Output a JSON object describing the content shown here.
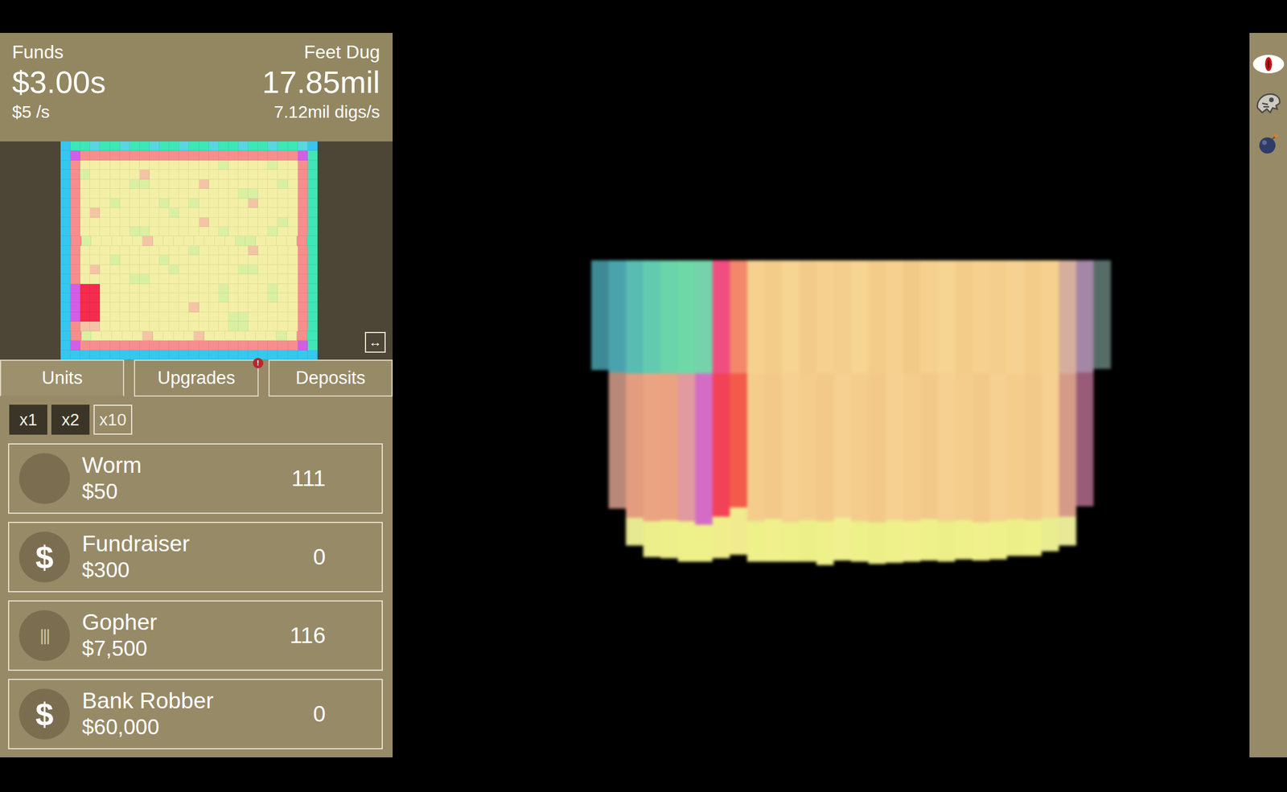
{
  "header": {
    "funds_label": "Funds",
    "funds": "$3.00s",
    "funds_rate": "$5 /s",
    "depth_label": "Feet Dug",
    "depth": "17.85mil",
    "dig_rate": "7.12mil digs/s"
  },
  "minimap": {
    "palette": {
      "a": "#38c6ef",
      "b": "#3fe6b6",
      "c": "#5ad6e0",
      "p": "#f78e8e",
      "m": "#d35ee6",
      "y": "#f3efa6",
      "g": "#d9f0a2",
      "o": "#f4c4a4",
      "r": "#f42c4e"
    },
    "rows": [
      "abbcbbcbbcbbcbbcbbcbbcbbca",
      "amppppppppppppppppppppppmb",
      "apyyyyyyyyyyyyyygyyyygyypb",
      "apgyyyyyoyyyyyyyyyyyyyyypb",
      "apyyyyyggyyyyyoyyyyyyygypb",
      "apyyyyyyyyyyyyyyyyggyyyypb",
      "apyyygyyyygyygyyyyyoyyyypb",
      "apyoyyyyyyygyyyyyyyyyyyypb",
      "apyyyyyyyyyyyyoyyyyyyygypb",
      "apyyyyyggyyyyyyygyyyygyypb",
      "apgyyyyyoyyyyyyyyggyyyypb",
      "apyyyyyyyyyyygyyyyyoyyyypb",
      "apyyygyyyygyyyyyyyyyyyyypb",
      "apyoyyyyyyygyyyyyyggyyyypb",
      "apyyyyyggyyyyyyyyyyyyyyypb",
      "amrryyyyyyyyyyyygyyyygyypb",
      "amrryyyyyyyyyyyygyyyygyypb",
      "amrryyyyyyyyyoyyyyyyyyyypb",
      "amrryyyyyyyyyyyyyggyyyyypb",
      "apooyyyyyyyyyyyyyggyyyyypb",
      "apgyyyyyoyyyyoyyyyyyygypb",
      "amppppppppppppppppppppppmb",
      "aaaaaaaaaaaaaaaaaaaaaaaaaa"
    ],
    "expand_button": "↔"
  },
  "tabs": [
    {
      "label": "Units",
      "selected": true
    },
    {
      "label": "Upgrades",
      "selected": false,
      "badge": "!"
    },
    {
      "label": "Deposits",
      "selected": false
    }
  ],
  "multipliers": [
    {
      "label": "x1",
      "selected": false
    },
    {
      "label": "x2",
      "selected": false
    },
    {
      "label": "x10",
      "selected": true
    }
  ],
  "units": [
    {
      "name": "Worm",
      "price": "$50",
      "count": "111",
      "kind": "plain"
    },
    {
      "name": "Fundraiser",
      "price": "$300",
      "count": "0",
      "kind": "dollar",
      "icon": "$"
    },
    {
      "name": "Gopher",
      "price": "$7,500",
      "count": "116",
      "kind": "bars",
      "icon": "|||"
    },
    {
      "name": "Bank Robber",
      "price": "$60,000",
      "count": "0",
      "kind": "dollar",
      "icon": "$"
    }
  ],
  "dig_view": {
    "columns": [
      {
        "segments": [
          {
            "color": "#3d8a94",
            "value": 190
          }
        ]
      },
      {
        "segments": [
          {
            "color": "#4aa3ac",
            "value": 194
          },
          {
            "color": "#b88878",
            "value": 236
          }
        ]
      },
      {
        "segments": [
          {
            "color": "#58bcb2",
            "value": 196
          },
          {
            "color": "#e49c7e",
            "value": 250
          },
          {
            "color": "#e6e892",
            "value": 48
          }
        ]
      },
      {
        "segments": [
          {
            "color": "#62cbaf",
            "value": 196
          },
          {
            "color": "#eba482",
            "value": 256
          },
          {
            "color": "#ecee8c",
            "value": 62
          }
        ]
      },
      {
        "segments": [
          {
            "color": "#6ad4aa",
            "value": 196
          },
          {
            "color": "#eaa280",
            "value": 254
          },
          {
            "color": "#edef8a",
            "value": 66
          }
        ]
      },
      {
        "segments": [
          {
            "color": "#6ed8a6",
            "value": 196
          },
          {
            "color": "#e09aa0",
            "value": 256
          },
          {
            "color": "#eef08a",
            "value": 70
          }
        ]
      },
      {
        "segments": [
          {
            "color": "#76d2aa",
            "value": 196
          },
          {
            "color": "#d46cc6",
            "value": 262
          },
          {
            "color": "#eef08a",
            "value": 64
          }
        ]
      },
      {
        "segments": [
          {
            "color": "#f04e80",
            "value": 196
          },
          {
            "color": "#f24258",
            "value": 248
          },
          {
            "color": "#f0ee8c",
            "value": 72
          }
        ]
      },
      {
        "segments": [
          {
            "color": "#f4866a",
            "value": 196
          },
          {
            "color": "#f25a4a",
            "value": 232
          },
          {
            "color": "#f2ea8e",
            "value": 82
          }
        ]
      },
      {
        "segments": [
          {
            "color": "#f5d08e",
            "value": 196
          },
          {
            "color": "#f4cd8c",
            "value": 256
          },
          {
            "color": "#eef08a",
            "value": 70
          }
        ]
      },
      {
        "segments": [
          {
            "color": "#f3cc8a",
            "value": 196
          },
          {
            "color": "#f2c988",
            "value": 252
          },
          {
            "color": "#f0f08c",
            "value": 74
          }
        ]
      },
      {
        "segments": [
          {
            "color": "#f6d492",
            "value": 196
          },
          {
            "color": "#f5d090",
            "value": 258
          },
          {
            "color": "#eef08a",
            "value": 68
          }
        ]
      },
      {
        "segments": [
          {
            "color": "#f2cb8a",
            "value": 196
          },
          {
            "color": "#f4cd8c",
            "value": 254
          },
          {
            "color": "#ecee88",
            "value": 72
          }
        ]
      },
      {
        "segments": [
          {
            "color": "#f5d08e",
            "value": 196
          },
          {
            "color": "#f2c988",
            "value": 256
          },
          {
            "color": "#eef08a",
            "value": 76
          }
        ]
      },
      {
        "segments": [
          {
            "color": "#f4ce8c",
            "value": 196
          },
          {
            "color": "#f5d090",
            "value": 250
          },
          {
            "color": "#f0f090",
            "value": 74
          }
        ]
      },
      {
        "segments": [
          {
            "color": "#f6d492",
            "value": 196
          },
          {
            "color": "#f4cd8c",
            "value": 256
          },
          {
            "color": "#eef08a",
            "value": 70
          }
        ]
      },
      {
        "segments": [
          {
            "color": "#f3cc8a",
            "value": 196
          },
          {
            "color": "#f2c988",
            "value": 258
          },
          {
            "color": "#ecee88",
            "value": 72
          }
        ]
      },
      {
        "segments": [
          {
            "color": "#f5d08e",
            "value": 196
          },
          {
            "color": "#f5d090",
            "value": 254
          },
          {
            "color": "#eef08a",
            "value": 74
          }
        ]
      },
      {
        "segments": [
          {
            "color": "#f2ca88",
            "value": 196
          },
          {
            "color": "#f4cd8c",
            "value": 256
          },
          {
            "color": "#f0f08c",
            "value": 70
          }
        ]
      },
      {
        "segments": [
          {
            "color": "#f5d08e",
            "value": 196
          },
          {
            "color": "#f2c988",
            "value": 252
          },
          {
            "color": "#eef08a",
            "value": 72
          }
        ]
      },
      {
        "segments": [
          {
            "color": "#f6d492",
            "value": 196
          },
          {
            "color": "#f5d090",
            "value": 256
          },
          {
            "color": "#ecee88",
            "value": 70
          }
        ]
      },
      {
        "segments": [
          {
            "color": "#f3cc8a",
            "value": 196
          },
          {
            "color": "#f4cd8c",
            "value": 254
          },
          {
            "color": "#eef08a",
            "value": 68
          }
        ]
      },
      {
        "segments": [
          {
            "color": "#f5d08e",
            "value": 196
          },
          {
            "color": "#f2c988",
            "value": 258
          },
          {
            "color": "#f0f08c",
            "value": 66
          }
        ]
      },
      {
        "segments": [
          {
            "color": "#f4ce8c",
            "value": 196
          },
          {
            "color": "#f5d090",
            "value": 256
          },
          {
            "color": "#eef08a",
            "value": 66
          }
        ]
      },
      {
        "segments": [
          {
            "color": "#f6d292",
            "value": 196
          },
          {
            "color": "#f4cd8c",
            "value": 252
          },
          {
            "color": "#ecee88",
            "value": 64
          }
        ]
      },
      {
        "segments": [
          {
            "color": "#f3cc8a",
            "value": 196
          },
          {
            "color": "#f2c988",
            "value": 254
          },
          {
            "color": "#eef08a",
            "value": 62
          }
        ]
      },
      {
        "segments": [
          {
            "color": "#f5d08e",
            "value": 196
          },
          {
            "color": "#f5d090",
            "value": 250
          },
          {
            "color": "#eaec90",
            "value": 58
          }
        ]
      },
      {
        "segments": [
          {
            "color": "#d6ae9e",
            "value": 196
          },
          {
            "color": "#d69a88",
            "value": 248
          },
          {
            "color": "#e8e896",
            "value": 50
          }
        ]
      },
      {
        "segments": [
          {
            "color": "#a486a6",
            "value": 194
          },
          {
            "color": "#985c78",
            "value": 232
          }
        ]
      },
      {
        "segments": [
          {
            "color": "#566c66",
            "value": 188
          }
        ]
      }
    ]
  }
}
